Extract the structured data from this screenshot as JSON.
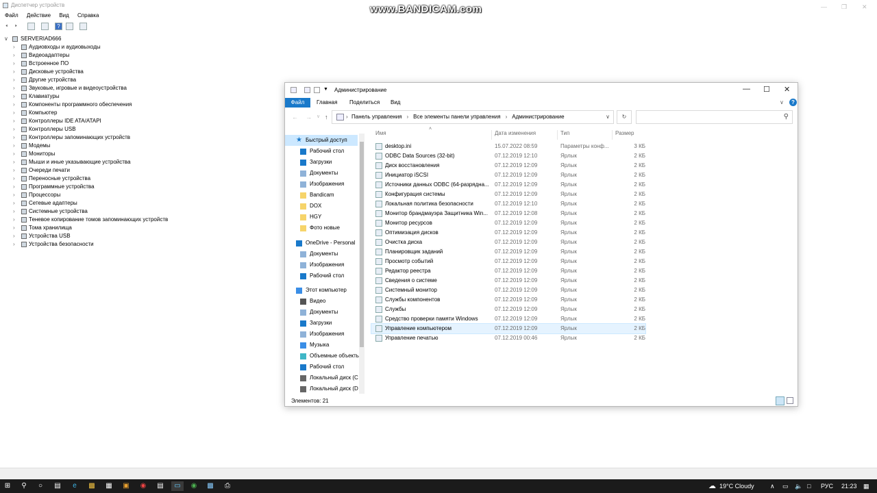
{
  "device_manager": {
    "title": "Диспетчер устройств",
    "menu": [
      "Файл",
      "Действие",
      "Вид",
      "Справка"
    ],
    "root": "SERVERIAD666",
    "items": [
      "Аудиовходы и аудиовыходы",
      "Видеоадаптеры",
      "Встроенное ПО",
      "Дисковые устройства",
      "Другие устройства",
      "Звуковые, игровые и видеоустройства",
      "Клавиатуры",
      "Компоненты программного обеспечения",
      "Компьютер",
      "Контроллеры IDE ATA/ATAPI",
      "Контроллеры USB",
      "Контроллеры запоминающих устройств",
      "Модемы",
      "Мониторы",
      "Мыши и иные указывающие устройства",
      "Очереди печати",
      "Переносные устройства",
      "Программные устройства",
      "Процессоры",
      "Сетевые адаптеры",
      "Системные устройства",
      "Теневое копирование томов запоминающих устройств",
      "Тома хранилища",
      "Устройства USB",
      "Устройства безопасности"
    ]
  },
  "watermark": "www.BANDICAM.com",
  "explorer": {
    "title": "Администрирование",
    "ribbon_tabs": [
      "Файл",
      "Главная",
      "Поделиться",
      "Вид"
    ],
    "breadcrumb": [
      "Панель управления",
      "Все элементы панели управления",
      "Администрирование"
    ],
    "columns": {
      "name": "Имя",
      "date": "Дата изменения",
      "type": "Тип",
      "size": "Размер"
    },
    "nav": {
      "quick_access": "Быстрый доступ",
      "quick_items": [
        "Рабочий стол",
        "Загрузки",
        "Документы",
        "Изображения",
        "Bandicam",
        "DOX",
        "HGY",
        "Фото новые"
      ],
      "onedrive": "OneDrive - Personal",
      "onedrive_items": [
        "Документы",
        "Изображения",
        "Рабочий стол"
      ],
      "this_pc": "Этот компьютер",
      "pc_items": [
        "Видео",
        "Документы",
        "Загрузки",
        "Изображения",
        "Музыка",
        "Объемные объекты",
        "Рабочий стол",
        "Локальный диск (C",
        "Локальный диск (D"
      ]
    },
    "files": [
      {
        "name": "desktop.ini",
        "date": "15.07.2022 08:59",
        "type": "Параметры конф...",
        "size": "3 КБ"
      },
      {
        "name": "ODBC Data Sources (32-bit)",
        "date": "07.12.2019 12:10",
        "type": "Ярлык",
        "size": "2 КБ"
      },
      {
        "name": "Диск восстановления",
        "date": "07.12.2019 12:09",
        "type": "Ярлык",
        "size": "2 КБ"
      },
      {
        "name": "Инициатор iSCSI",
        "date": "07.12.2019 12:09",
        "type": "Ярлык",
        "size": "2 КБ"
      },
      {
        "name": "Источники данных ODBC (64-разрядна...",
        "date": "07.12.2019 12:09",
        "type": "Ярлык",
        "size": "2 КБ"
      },
      {
        "name": "Конфигурация системы",
        "date": "07.12.2019 12:09",
        "type": "Ярлык",
        "size": "2 КБ"
      },
      {
        "name": "Локальная политика безопасности",
        "date": "07.12.2019 12:10",
        "type": "Ярлык",
        "size": "2 КБ"
      },
      {
        "name": "Монитор брандмауэра Защитника Win...",
        "date": "07.12.2019 12:08",
        "type": "Ярлык",
        "size": "2 КБ"
      },
      {
        "name": "Монитор ресурсов",
        "date": "07.12.2019 12:09",
        "type": "Ярлык",
        "size": "2 КБ"
      },
      {
        "name": "Оптимизация дисков",
        "date": "07.12.2019 12:09",
        "type": "Ярлык",
        "size": "2 КБ"
      },
      {
        "name": "Очистка диска",
        "date": "07.12.2019 12:09",
        "type": "Ярлык",
        "size": "2 КБ"
      },
      {
        "name": "Планировщик заданий",
        "date": "07.12.2019 12:09",
        "type": "Ярлык",
        "size": "2 КБ"
      },
      {
        "name": "Просмотр событий",
        "date": "07.12.2019 12:09",
        "type": "Ярлык",
        "size": "2 КБ"
      },
      {
        "name": "Редактор реестра",
        "date": "07.12.2019 12:09",
        "type": "Ярлык",
        "size": "2 КБ"
      },
      {
        "name": "Сведения о системе",
        "date": "07.12.2019 12:09",
        "type": "Ярлык",
        "size": "2 КБ"
      },
      {
        "name": "Системный монитор",
        "date": "07.12.2019 12:09",
        "type": "Ярлык",
        "size": "2 КБ"
      },
      {
        "name": "Службы компонентов",
        "date": "07.12.2019 12:09",
        "type": "Ярлык",
        "size": "2 КБ"
      },
      {
        "name": "Службы",
        "date": "07.12.2019 12:09",
        "type": "Ярлык",
        "size": "2 КБ"
      },
      {
        "name": "Средство проверки памяти Windows",
        "date": "07.12.2019 12:09",
        "type": "Ярлык",
        "size": "2 КБ"
      },
      {
        "name": "Управление компьютером",
        "date": "07.12.2019 12:09",
        "type": "Ярлык",
        "size": "2 КБ",
        "selected": true
      },
      {
        "name": "Управление печатью",
        "date": "07.12.2019 00:46",
        "type": "Ярлык",
        "size": "2 КБ"
      }
    ],
    "status": "Элементов: 21"
  },
  "taskbar": {
    "weather": "19°C Cloudy",
    "lang": "РУС",
    "time": "21:23"
  },
  "colors": {
    "accent": "#1979ca",
    "selection": "#e5f3ff",
    "taskbar": "#1b1b1b"
  }
}
